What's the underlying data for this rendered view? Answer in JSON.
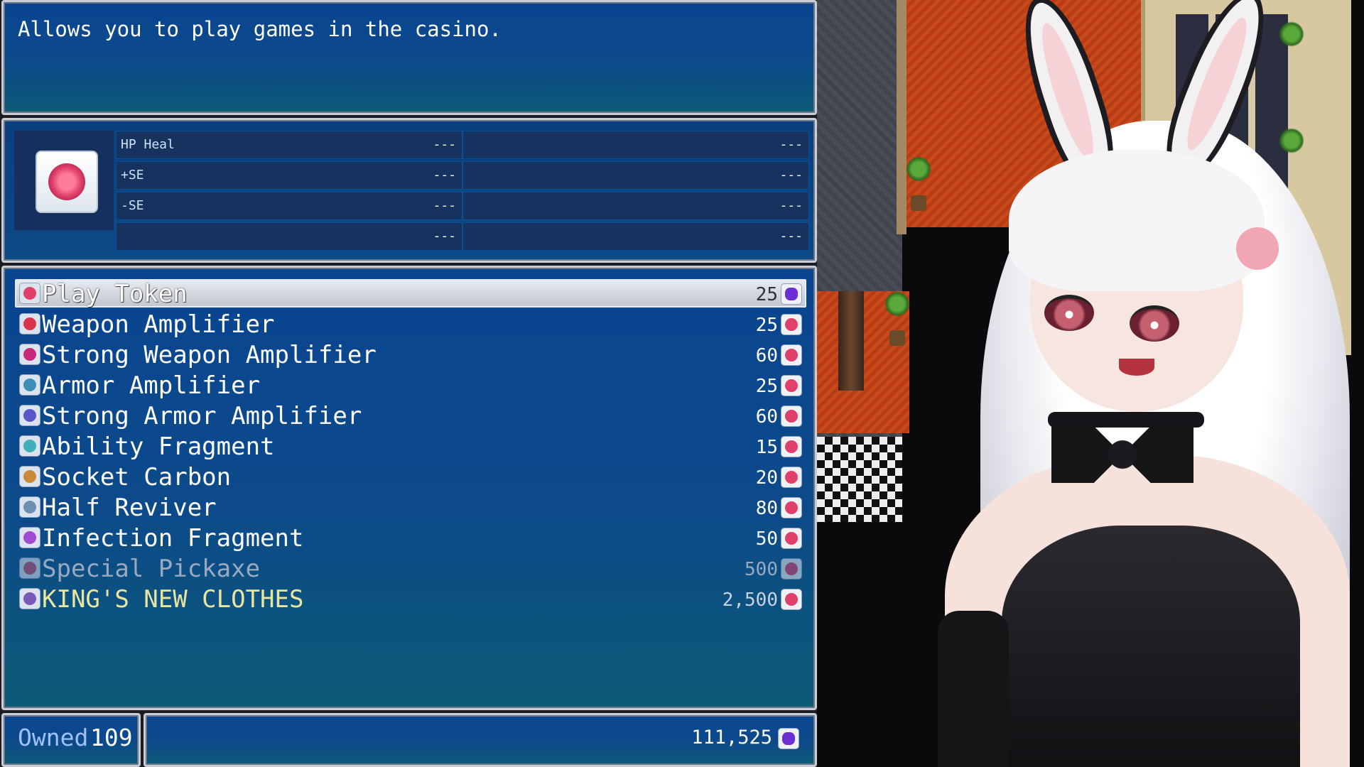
{
  "help": {
    "text": "Allows you to play games in the casino."
  },
  "status": {
    "item_icon": "play-token-icon",
    "rows": [
      {
        "label": "HP Heal",
        "left": "---",
        "right": "---"
      },
      {
        "label": "+SE",
        "left": "---",
        "right": "---"
      },
      {
        "label": "-SE",
        "left": "---",
        "right": "---"
      },
      {
        "label": "",
        "left": "---",
        "right": "---"
      }
    ]
  },
  "shop": {
    "items": [
      {
        "name": "Play Token",
        "price": "25",
        "icon": "play-token-icon",
        "currency_icon": "purple-gem-icon"
      },
      {
        "name": "Weapon Amplifier",
        "price": "25",
        "icon": "weapon-amplifier-icon",
        "currency_icon": "play-token-coin-icon"
      },
      {
        "name": "Strong Weapon Amplifier",
        "price": "60",
        "icon": "strong-weapon-amplifier-icon",
        "currency_icon": "play-token-coin-icon"
      },
      {
        "name": "Armor Amplifier",
        "price": "25",
        "icon": "armor-amplifier-icon",
        "currency_icon": "play-token-coin-icon"
      },
      {
        "name": "Strong Armor Amplifier",
        "price": "60",
        "icon": "strong-armor-amplifier-icon",
        "currency_icon": "play-token-coin-icon"
      },
      {
        "name": "Ability Fragment",
        "price": "15",
        "icon": "ability-fragment-icon",
        "currency_icon": "play-token-coin-icon"
      },
      {
        "name": "Socket Carbon",
        "price": "20",
        "icon": "socket-carbon-icon",
        "currency_icon": "play-token-coin-icon"
      },
      {
        "name": "Half Reviver",
        "price": "80",
        "icon": "half-reviver-icon",
        "currency_icon": "play-token-coin-icon"
      },
      {
        "name": "Infection Fragment",
        "price": "50",
        "icon": "infection-fragment-icon",
        "currency_icon": "play-token-coin-icon"
      },
      {
        "name": "Special Pickaxe",
        "price": "500",
        "icon": "special-pickaxe-icon",
        "currency_icon": "play-token-coin-icon"
      },
      {
        "name": "KING'S NEW CLOTHES",
        "price": "2,500",
        "icon": "kings-new-clothes-icon",
        "currency_icon": "play-token-coin-icon"
      }
    ],
    "selected_index": 0,
    "disabled_items": [
      "Special Pickaxe"
    ],
    "highlighted_items": [
      "KING'S NEW CLOTHES"
    ]
  },
  "owned": {
    "label": "Owned",
    "value": "109"
  },
  "currency": {
    "value": "111,525",
    "icon": "purple-gem-icon"
  },
  "colors": {
    "window_top": "#0a4591",
    "window_bottom": "#0b5a75",
    "owned_label": "#9fc2ff",
    "special_item": "#e8e5a0",
    "disabled_item": "#98a9c0"
  }
}
